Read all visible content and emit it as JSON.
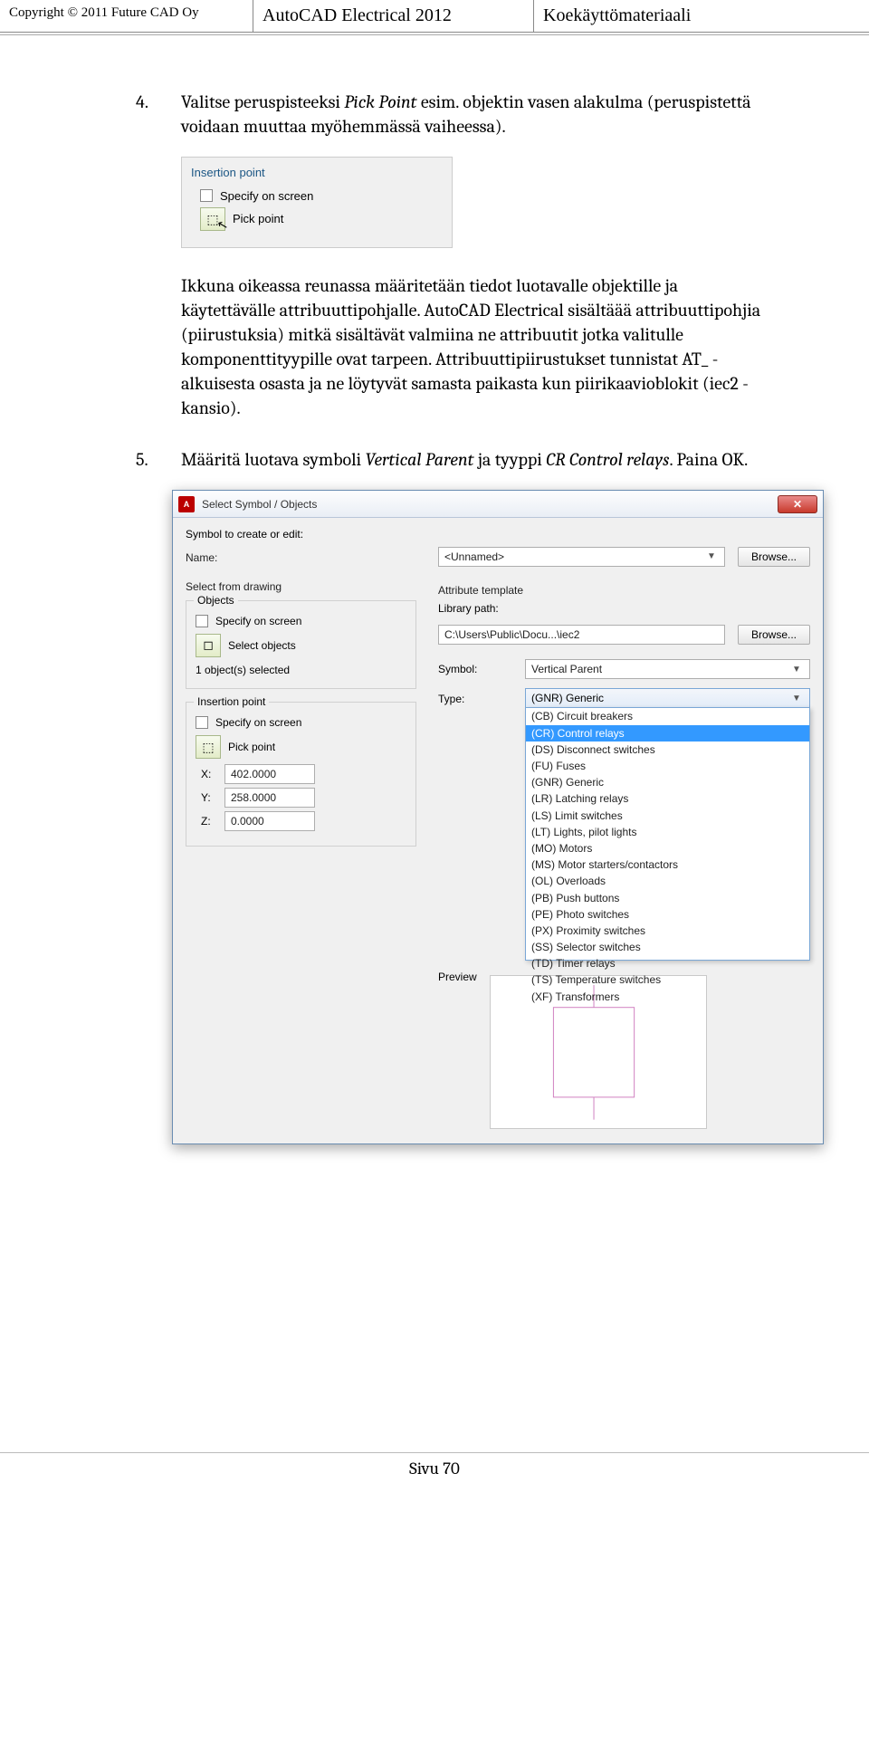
{
  "header": {
    "copyright": "Copyright © 2011 Future CAD Oy",
    "title": "AutoCAD Electrical 2012",
    "right": "Koekäyttömateriaali"
  },
  "step4": {
    "num": "4.",
    "text_a": "Valitse peruspisteeksi ",
    "text_b": "Pick Point",
    "text_c": " esim. objektin vasen alakulma (peruspistettä voidaan muuttaa myöhemmässä vaiheessa)."
  },
  "insShot": {
    "group": "Insertion point",
    "specify": "Specify on screen",
    "pick": "Pick point"
  },
  "paragraph": "Ikkuna oikeassa reunassa määritetään tiedot luotavalle objektille ja käytettävälle attribuuttipohjalle. AutoCAD Electrical sisältäää attribuuttipohjia (piirustuksia) mitkä sisältävät valmiina ne attribuutit jotka valitulle komponenttityypille ovat tarpeen. Attribuuttipiirustukset tunnistat AT_ -alkuisesta osasta ja ne löytyvät samasta paikasta kun piirikaavioblokit (iec2 -kansio).",
  "step5": {
    "num": "5.",
    "text_a": "Määritä luotava symboli ",
    "text_b": "Vertical Parent",
    "text_c": " ja tyyppi ",
    "text_d": "CR Control relays",
    "text_e": ". Paina OK."
  },
  "dlg": {
    "title": "Select Symbol / Objects",
    "symbolEditLbl": "Symbol to create or edit:",
    "nameLbl": "Name:",
    "nameVal": "<Unnamed>",
    "browse": "Browse...",
    "selectFrom": "Select from drawing",
    "objectsGrp": "Objects",
    "specify": "Specify on screen",
    "selectObjects": "Select objects",
    "selectedCount": "1 object(s) selected",
    "insertionGrp": "Insertion point",
    "pickPoint": "Pick point",
    "x": "X:",
    "y": "Y:",
    "z": "Z:",
    "xVal": "402.0000",
    "yVal": "258.0000",
    "zVal": "0.0000",
    "attrTemplate": "Attribute template",
    "libPathLbl": "Library path:",
    "libPathVal": "C:\\Users\\Public\\Docu...\\iec2",
    "symbolLbl": "Symbol:",
    "symbolVal": "Vertical Parent",
    "typeLbl": "Type:",
    "typeSel": "(GNR) Generic",
    "typeOptions": [
      "(CB) Circuit breakers",
      "(CR) Control relays",
      "(DS) Disconnect switches",
      "(FU) Fuses",
      "(GNR) Generic",
      "(LR) Latching relays",
      "(LS) Limit switches",
      "(LT) Lights, pilot lights",
      "(MO) Motors",
      "(MS) Motor starters/contactors",
      "(OL) Overloads",
      "(PB) Push buttons",
      "(PE) Photo switches",
      "(PX) Proximity switches",
      "(SS) Selector switches",
      "(TD) Timer relays",
      "(TS) Temperature switches",
      "(XF) Transformers"
    ],
    "typeHighlightIndex": 1,
    "previewLbl": "Preview"
  },
  "footer": "Sivu 70"
}
